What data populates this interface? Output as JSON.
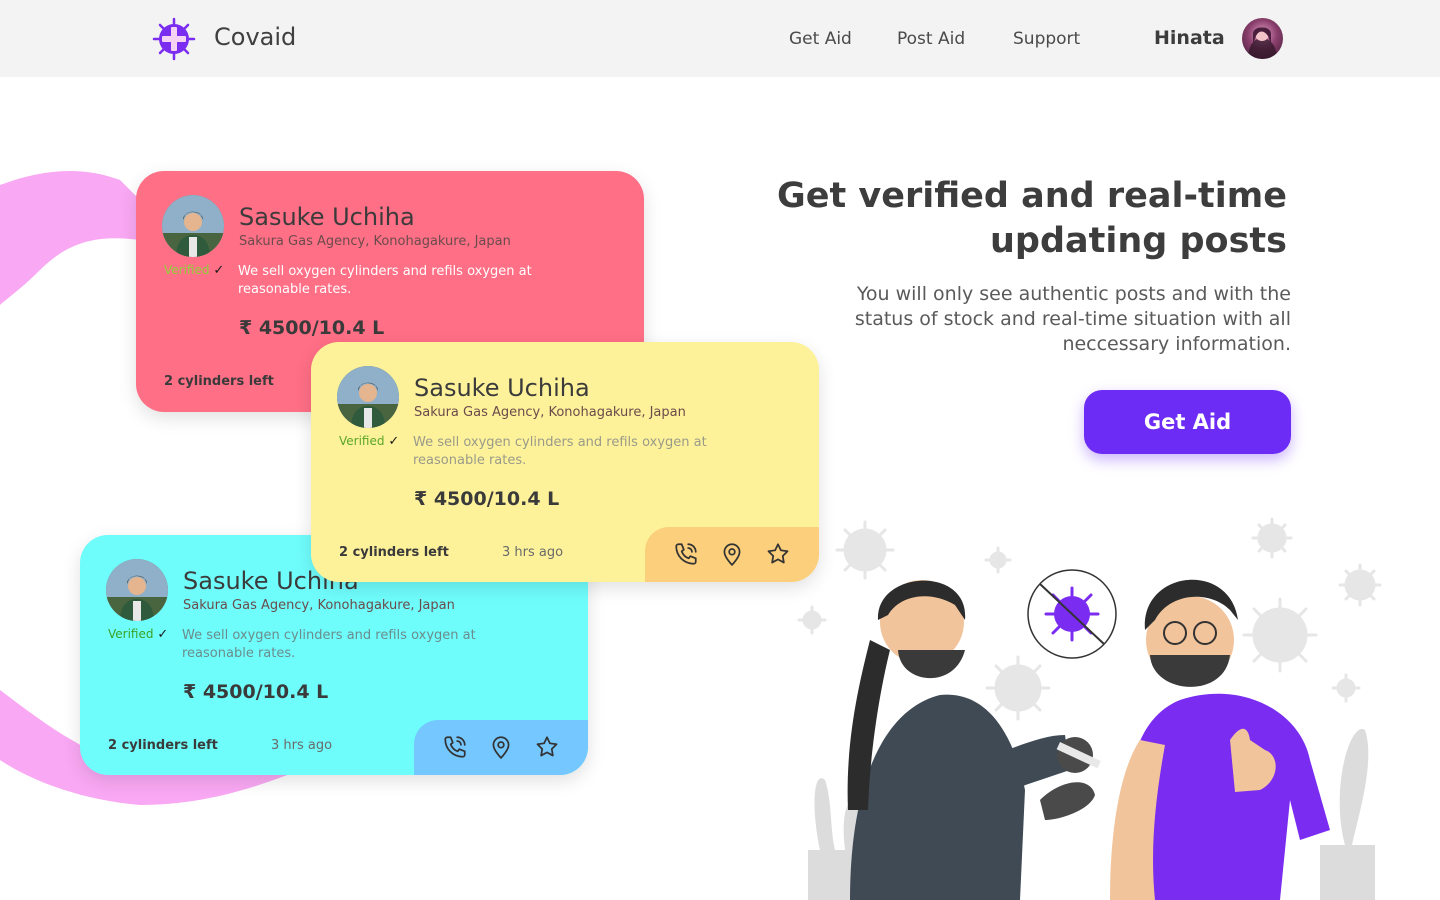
{
  "header": {
    "brand": "Covaid",
    "nav": [
      "Get Aid",
      "Post Aid",
      "Support"
    ],
    "user_name": "Hinata"
  },
  "cards": [
    {
      "name": "Sasuke Uchiha",
      "agency": "Sakura Gas Agency, Konohagakure, Japan",
      "verified": "Verified",
      "verified_mark": "✓",
      "description": "We sell oxygen cylinders and refils oxygen at reasonable rates.",
      "price": "₹ 4500/10.4 L",
      "stock": "2 cylinders left"
    },
    {
      "name": "Sasuke Uchiha",
      "agency": "Sakura Gas Agency, Konohagakure, Japan",
      "verified": "Verified",
      "verified_mark": "✓",
      "description": "We sell oxygen cylinders and refils oxygen at reasonable rates.",
      "price": "₹ 4500/10.4 L",
      "stock": "2 cylinders left",
      "time": "3 hrs ago"
    },
    {
      "name": "Sasuke Uchiha",
      "agency": "Sakura Gas Agency, Konohagakure, Japan",
      "verified": "Verified",
      "verified_mark": "✓",
      "description": "We sell oxygen cylinders and refils oxygen at reasonable rates.",
      "price": "₹ 4500/10.4 L",
      "stock": "2 cylinders left",
      "time": "3 hrs ago"
    }
  ],
  "card_icons": [
    "phone-icon",
    "location-pin-icon",
    "star-icon"
  ],
  "hero": {
    "title_line1": "Get verified and real-time",
    "title_line2": "updating posts",
    "subtitle": "You will only see authentic posts and with the status of stock and real-time situation with all neccessary information.",
    "cta": "Get Aid"
  },
  "colors": {
    "accent": "#6c2cf6",
    "card_pink": "#ff6f86",
    "card_yellow": "#fdf29a",
    "card_cyan": "#6ffdfc",
    "blob": "#f9a8f3"
  }
}
